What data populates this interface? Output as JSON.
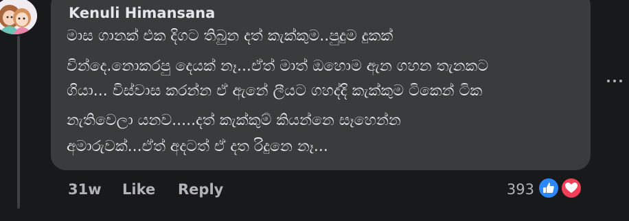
{
  "comment": {
    "author": "Kenuli Himansana",
    "lines": [
      "මාස ගානක් එක දිගට තිබුන දත් කැක්කුම..පුදුම දුකක්",
      "වින්දෙ.නොකරපු දෙයක් නෑ...ඒත් මාත් ඔහොම ඇන ගහන තැනකට",
      "ගියා... විස්වාස කරන්න ඒ ඇනේ ලීයට ගහද්දි කැක්කුම ටිකෙන් ටික",
      "නැතිවෙලා යනව.....දත් කැක්කුම් කියන්නෙ සෑහෙන්න",
      "අමාරුවක්...ඒත් අදටත් ඒ දත රිදුනෙ නෑ..."
    ],
    "time": "31w",
    "like_label": "Like",
    "reply_label": "Reply",
    "reaction_count": "393",
    "reactions": [
      "like-icon",
      "love-icon"
    ],
    "more_icon": "more-options-icon"
  },
  "colors": {
    "page_bg": "#18191a",
    "bubble_bg": "#3a3b3c",
    "text_primary": "#e4e6eb",
    "text_secondary": "#b0b3b8",
    "like_blue": "#2d88ff",
    "love_red": "#f33e58"
  }
}
